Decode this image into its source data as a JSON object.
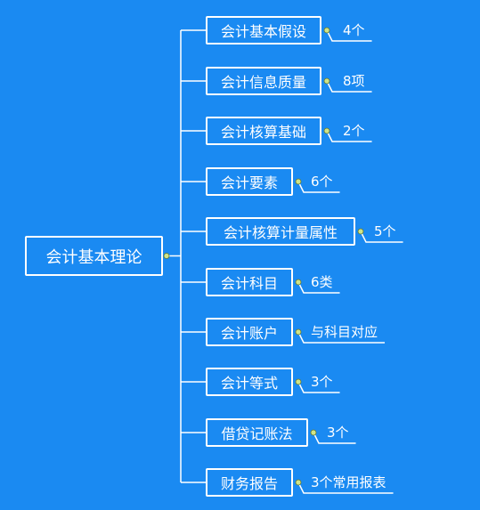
{
  "root": {
    "label": "会计基本理论"
  },
  "branches": [
    {
      "label": "会计基本假设",
      "note": "4个"
    },
    {
      "label": "会计信息质量",
      "note": "8项"
    },
    {
      "label": "会计核算基础",
      "note": "2个"
    },
    {
      "label": "会计要素",
      "note": "6个"
    },
    {
      "label": "会计核算计量属性",
      "note": "5个"
    },
    {
      "label": "会计科目",
      "note": "6类"
    },
    {
      "label": "会计账户",
      "note": "与科目对应"
    },
    {
      "label": "会计等式",
      "note": "3个"
    },
    {
      "label": "借贷记账法",
      "note": "3个"
    },
    {
      "label": "财务报告",
      "note": "3个常用报表"
    }
  ],
  "colors": {
    "background": "#1a8af2",
    "line": "#ffffff",
    "knob": "#cfe48a"
  }
}
